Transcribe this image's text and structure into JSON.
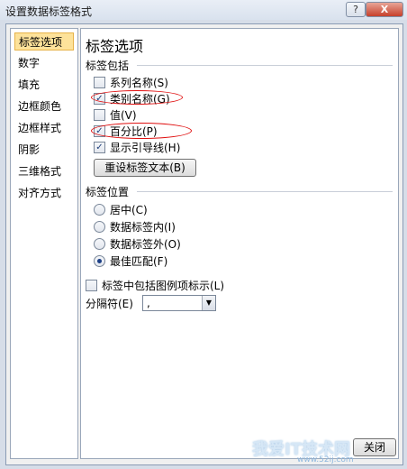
{
  "window": {
    "title": "设置数据标签格式",
    "help": "?",
    "close": "X"
  },
  "nav": [
    {
      "label": "标签选项",
      "active": true
    },
    {
      "label": "数字"
    },
    {
      "label": "填充"
    },
    {
      "label": "边框颜色"
    },
    {
      "label": "边框样式"
    },
    {
      "label": "阴影"
    },
    {
      "label": "三维格式"
    },
    {
      "label": "对齐方式"
    }
  ],
  "panel": {
    "title": "标签选项",
    "contains_label": "标签包括",
    "contains": [
      {
        "label": "系列名称(S)",
        "checked": false
      },
      {
        "label": "类别名称(G)",
        "checked": true
      },
      {
        "label": "值(V)",
        "checked": false
      },
      {
        "label": "百分比(P)",
        "checked": true
      },
      {
        "label": "显示引导线(H)",
        "checked": true
      }
    ],
    "reset_button": "重设标签文本(B)",
    "position_label": "标签位置",
    "positions": [
      {
        "label": "居中(C)",
        "selected": false
      },
      {
        "label": "数据标签内(I)",
        "selected": false
      },
      {
        "label": "数据标签外(O)",
        "selected": false
      },
      {
        "label": "最佳匹配(F)",
        "selected": true
      }
    ],
    "legend_key": {
      "label": "标签中包括图例项标示(L)",
      "checked": false
    },
    "separator": {
      "label": "分隔符(E)",
      "value": ","
    }
  },
  "footer": {
    "close_button": "关闭"
  },
  "watermark": {
    "text": "我爱IT技术网",
    "url": "www.52ij.com"
  },
  "colors": {
    "highlight": "#fde29a",
    "annotation": "#e01010"
  }
}
